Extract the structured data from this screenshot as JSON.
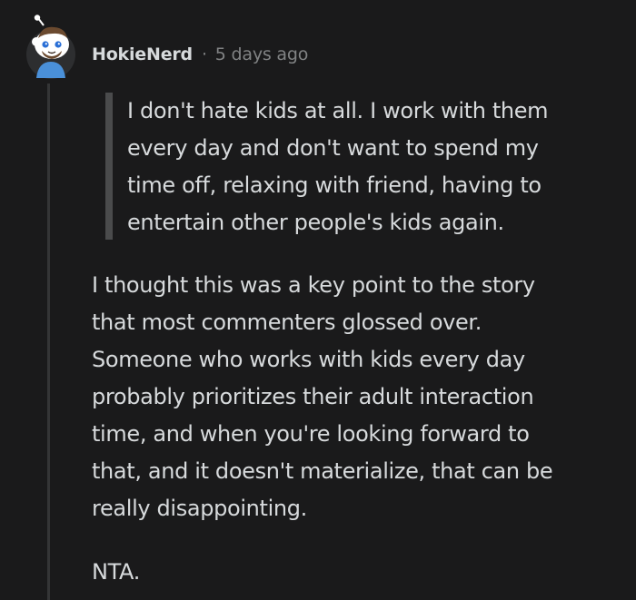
{
  "comment": {
    "author": "HokieNerd",
    "separator": "·",
    "timestamp": "5 days ago",
    "quote_lines": [
      "I don't hate kids at all. I work with them",
      "every day and don't want to spend my",
      "time off, relaxing with friend, having to",
      "entertain other people's kids again."
    ],
    "body_lines": [
      "I thought this was a key point to the story",
      "that most commenters glossed over.",
      "Someone who works with kids every day",
      "probably prioritizes their adult interaction",
      "time, and when you're looking forward to",
      "that, and it doesn't materialize, that can be",
      "really disappointing."
    ],
    "signoff": "NTA."
  },
  "colors": {
    "background": "#1a1a1b",
    "text": "#d7dadc",
    "muted": "#818384",
    "quote_bar": "#4a4b4c",
    "thread_line": "#343536",
    "avatar_shirt": "#4a90d9"
  },
  "icons": {
    "avatar": "snoo-avatar-icon"
  }
}
